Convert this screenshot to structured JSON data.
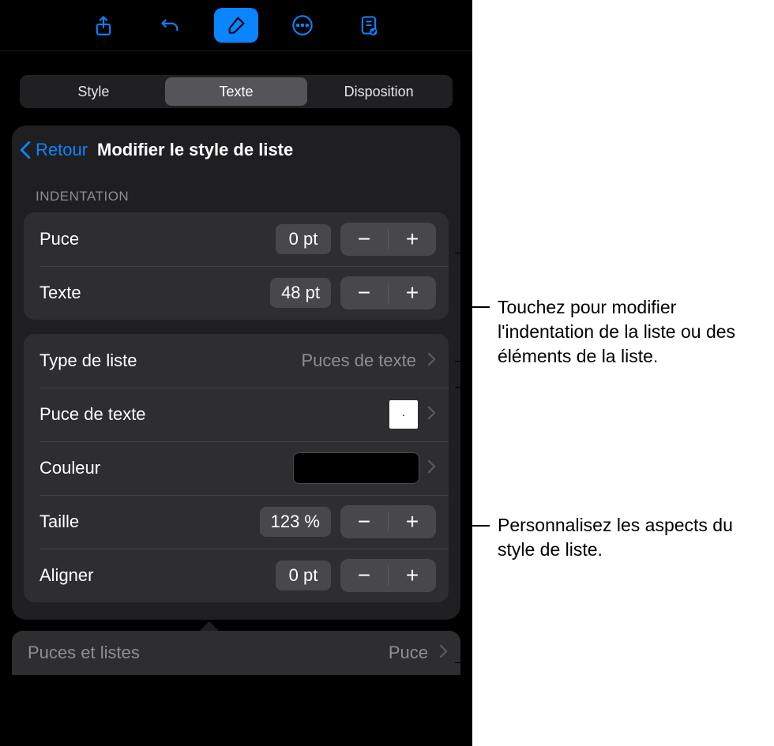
{
  "toolbar": {
    "icons": [
      "share-icon",
      "undo-icon",
      "brush-icon",
      "more-icon",
      "insert-icon"
    ]
  },
  "tabs": {
    "items": [
      "Style",
      "Texte",
      "Disposition"
    ],
    "selected": 1
  },
  "nav": {
    "back_label": "Retour",
    "title": "Modifier le style de liste"
  },
  "indent": {
    "header": "INDENTATION",
    "bullet_label": "Puce",
    "bullet_value": "0 pt",
    "text_label": "Texte",
    "text_value": "48 pt"
  },
  "style": {
    "list_type_label": "Type de liste",
    "list_type_value": "Puces de texte",
    "text_bullet_label": "Puce de texte",
    "text_bullet_glyph": "·",
    "color_label": "Couleur",
    "color_value": "#000000",
    "size_label": "Taille",
    "size_value": "123 %",
    "align_label": "Aligner",
    "align_value": "0 pt"
  },
  "bottom": {
    "label": "Puces et listes",
    "value": "Puce"
  },
  "steppers": {
    "minus": "−",
    "plus": "+"
  },
  "callouts": {
    "indent": "Touchez pour modifier l'indentation de la liste ou des éléments de la liste.",
    "style": "Personnalisez les aspects du style de liste."
  }
}
